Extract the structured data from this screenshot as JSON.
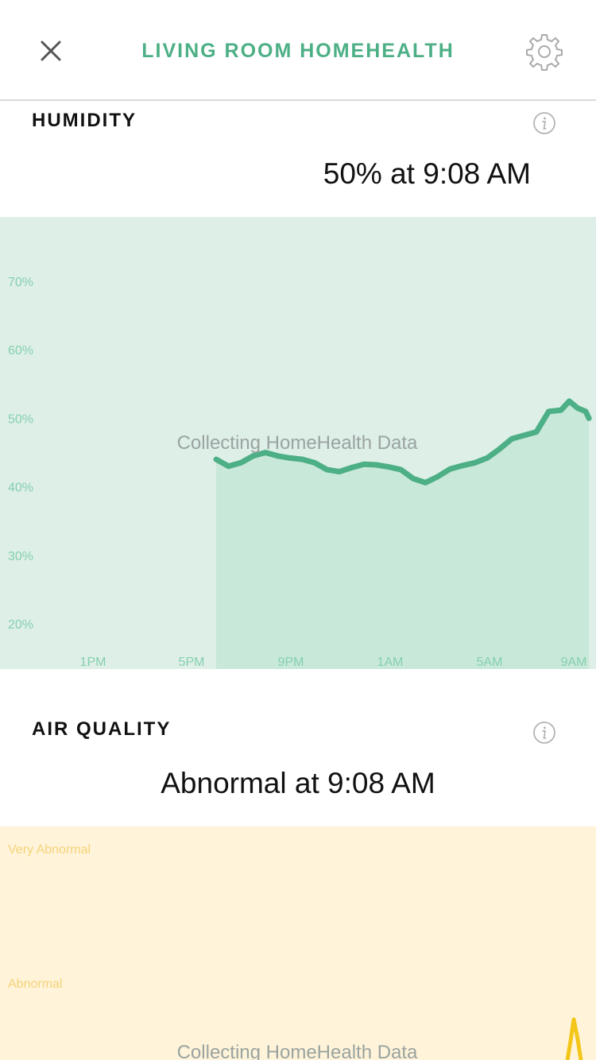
{
  "nav": {
    "title": "LIVING ROOM HOMEHEALTH",
    "close_icon": "close-icon",
    "settings_icon": "gear-icon",
    "accent_color": "#4caf85"
  },
  "humidity": {
    "title": "HUMIDITY",
    "reading": "50% at 9:08 AM",
    "info_icon": "info-icon",
    "collecting_text": "Collecting HomeHealth Data",
    "colors": {
      "background": "#deefe8",
      "fill": "#c8e8d9",
      "line": "#4caf85",
      "labels": "#84d0ae"
    }
  },
  "air_quality": {
    "title": "AIR QUALITY",
    "reading": "Abnormal at 9:08 AM",
    "info_icon": "info-icon",
    "collecting_text": "Collecting HomeHealth Data",
    "y_labels": [
      "Very Abnormal",
      "Abnormal"
    ],
    "colors": {
      "background": "#fff4d9",
      "labels": "#f5d27a",
      "line": "#f3c619"
    }
  },
  "chart_data": [
    {
      "type": "area",
      "series": [
        {
          "x": [
            "6:00 PM",
            "6:30 PM",
            "7:00 PM",
            "7:30 PM",
            "8:00 PM",
            "8:30 PM",
            "9:00 PM",
            "9:30 PM",
            "10:00 PM",
            "10:30 PM",
            "11:00 PM",
            "11:30 PM",
            "12:00 AM",
            "12:30 AM",
            "1:00 AM",
            "1:30 AM",
            "2:00 AM",
            "2:30 AM",
            "3:00 AM",
            "3:30 AM",
            "4:00 AM",
            "4:30 AM",
            "5:00 AM",
            "5:30 AM",
            "6:00 AM",
            "6:30 AM",
            "7:00 AM",
            "7:30 AM",
            "8:00 AM",
            "8:20 AM",
            "8:40 AM",
            "9:00 AM",
            "9:08 AM"
          ],
          "values": [
            44,
            43,
            43.5,
            44.5,
            45,
            44.5,
            44.2,
            44,
            43.5,
            42.5,
            42.2,
            42.8,
            43.3,
            43.2,
            42.9,
            42.5,
            41.2,
            40.6,
            41.5,
            42.6,
            43.1,
            43.5,
            44.2,
            45.5,
            47,
            47.5,
            48,
            51,
            51.2,
            52.5,
            51.5,
            51,
            50
          ]
        }
      ],
      "x_tick_labels": [
        "1PM",
        "5PM",
        "9PM",
        "1AM",
        "5AM",
        "9AM"
      ],
      "y_tick_labels": [
        "70%",
        "60%",
        "50%",
        "40%",
        "30%",
        "20%"
      ],
      "ylim": [
        15,
        80
      ],
      "grid": false,
      "annotation": "Collecting HomeHealth Data"
    },
    {
      "type": "line",
      "y_tick_labels": [
        "Very Abnormal",
        "Abnormal"
      ],
      "annotation": "Collecting HomeHealth Data"
    }
  ]
}
